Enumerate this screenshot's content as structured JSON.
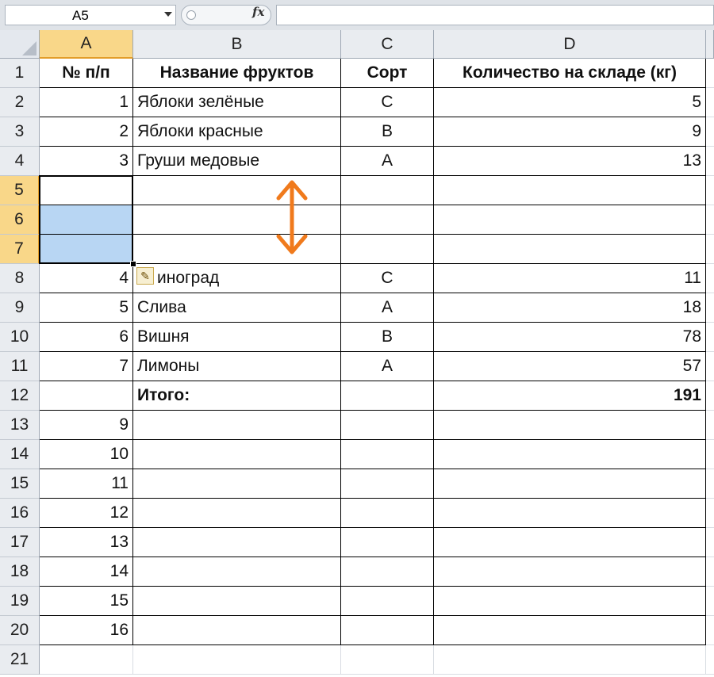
{
  "formula_bar": {
    "name_box": "A5",
    "fx_label": "fx",
    "formula": ""
  },
  "columns": [
    "A",
    "B",
    "C",
    "D"
  ],
  "rows": [
    "1",
    "2",
    "3",
    "4",
    "5",
    "6",
    "7",
    "8",
    "9",
    "10",
    "11",
    "12",
    "13",
    "14",
    "15",
    "16",
    "17",
    "18",
    "19",
    "20",
    "21"
  ],
  "table": {
    "header": {
      "a": "№ п/п",
      "b": "Название фруктов",
      "c": "Сорт",
      "d": "Количество на складе (кг)"
    },
    "r2": {
      "a": "1",
      "b": "Яблоки зелёные",
      "c": "С",
      "d": "5"
    },
    "r3": {
      "a": "2",
      "b": "Яблоки красные",
      "c": "В",
      "d": "9"
    },
    "r4": {
      "a": "3",
      "b": "Груши медовые",
      "c": "А",
      "d": "13"
    },
    "r8": {
      "a": "4",
      "b": "иноград",
      "c": "С",
      "d": "11"
    },
    "r9": {
      "a": "5",
      "b": "Слива",
      "c": "А",
      "d": "18"
    },
    "r10": {
      "a": "6",
      "b": "Вишня",
      "c": "В",
      "d": "78"
    },
    "r11": {
      "a": "7",
      "b": "Лимоны",
      "c": "А",
      "d": "57"
    },
    "r12": {
      "b": "Итого:",
      "d": "191"
    },
    "r13": {
      "a": "9"
    },
    "r14": {
      "a": "10"
    },
    "r15": {
      "a": "11"
    },
    "r16": {
      "a": "12"
    },
    "r17": {
      "a": "13"
    },
    "r18": {
      "a": "14"
    },
    "r19": {
      "a": "15"
    },
    "r20": {
      "a": "16"
    }
  },
  "selection": {
    "active_cell": "A5",
    "range": "A5:A7"
  },
  "icons": {
    "paste_options": "paste-brush-icon",
    "resize_arrow": "up-down-arrow-icon"
  },
  "colors": {
    "selection": "#b8d6f3",
    "active_header": "#f9d789",
    "arrow": "#f07a1c"
  }
}
